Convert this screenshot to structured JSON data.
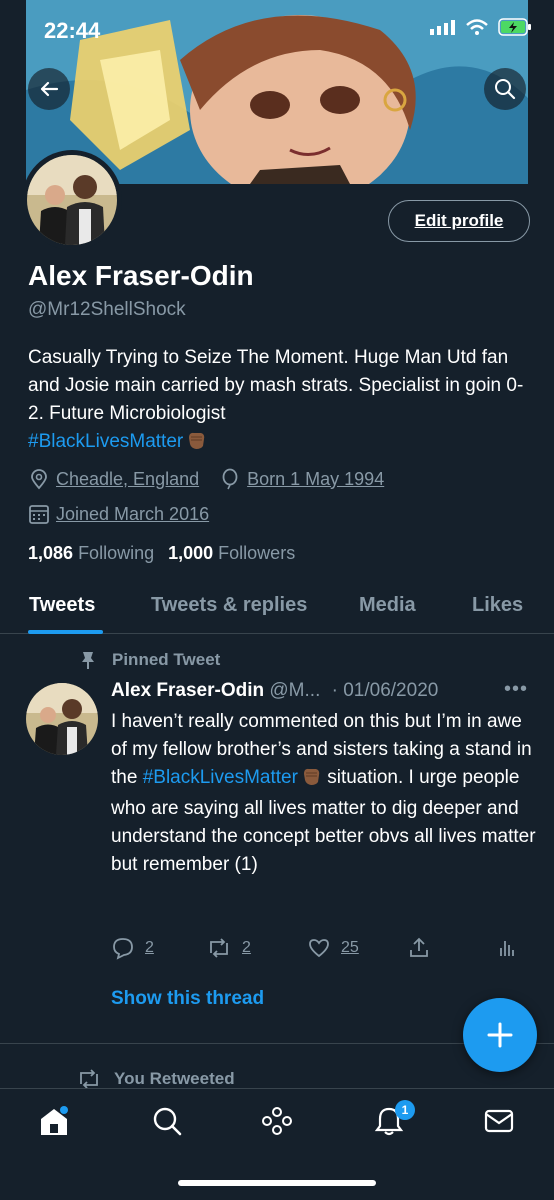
{
  "status_bar": {
    "time": "22:44"
  },
  "profile": {
    "name": "Alex Fraser-Odin",
    "handle": "@Mr12ShellShock",
    "bio_text": "Casually Trying to Seize The Moment. Huge Man Utd fan and Josie main carried by mash strats. Specialist in goin 0-2. Future Microbiologist",
    "bio_hashtag": "#BlackLivesMatter",
    "location": "Cheadle, England",
    "birthday": "Born 1 May 1994",
    "joined": "Joined March 2016",
    "following_count": "1,086",
    "following_label": "Following",
    "followers_count": "1,000",
    "followers_label": "Followers",
    "edit_label": "Edit profile"
  },
  "tabs": [
    "Tweets",
    "Tweets & replies",
    "Media",
    "Likes"
  ],
  "pinned_tweet": {
    "pinned_label": "Pinned Tweet",
    "author_name": "Alex Fraser-Odin",
    "author_handle": "@M...",
    "date": "· 01/06/2020",
    "text_before": "I haven’t really commented on this but I’m in awe of my fellow brother’s and sisters taking a stand in the ",
    "hashtag": "#BlackLivesMatter",
    "text_after": " situation. I urge people who are saying all lives matter to dig deeper and understand the concept better obvs all lives matter but remember (1)",
    "replies": "2",
    "retweets": "2",
    "likes": "25",
    "show_thread": "Show this thread"
  },
  "next_item": {
    "retweeted_label": "You Retweeted"
  },
  "nav": {
    "notifications_badge": "1"
  },
  "colors": {
    "background": "#15202b",
    "accent": "#1d9bf0",
    "muted": "#8899a6"
  }
}
